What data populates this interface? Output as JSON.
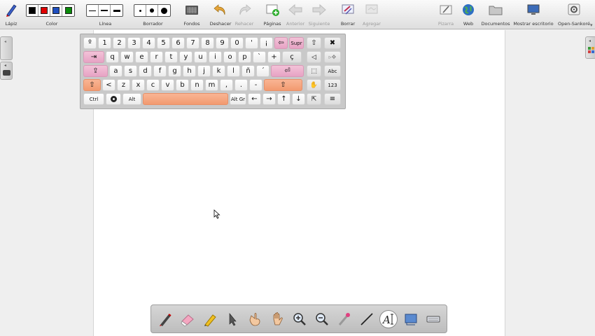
{
  "toolbar": {
    "lapiz": "Lápiz",
    "color": "Color",
    "linea": "Línea",
    "borrador": "Borrador",
    "fondos": "Fondos",
    "deshacer": "Deshacer",
    "rehacer": "Rehacer",
    "paginas": "Páginas",
    "anterior": "Anterior",
    "siguiente": "Siguiente",
    "borrar": "Borrar",
    "agregar": "Agregar",
    "pizarra": "Pizarra",
    "web": "Web",
    "documentos": "Documentos",
    "mostrar_escritorio": "Mostrar escritorio",
    "open_sankore": "Open-Sankoré",
    "colors": [
      "#000000",
      "#e00000",
      "#1f4fbf",
      "#0a8a0a"
    ]
  },
  "keyboard": {
    "row1": [
      "º",
      "1",
      "2",
      "3",
      "4",
      "5",
      "6",
      "7",
      "8",
      "9",
      "0",
      "'",
      "¡",
      "⇦",
      "Supr"
    ],
    "row2": [
      "⇥",
      "q",
      "w",
      "e",
      "r",
      "t",
      "y",
      "u",
      "i",
      "o",
      "p",
      "`",
      "+",
      "ç"
    ],
    "row3": [
      "⇪",
      "a",
      "s",
      "d",
      "f",
      "g",
      "h",
      "j",
      "k",
      "l",
      "ñ",
      "´",
      "⏎"
    ],
    "row4": [
      "⇧",
      "<",
      "z",
      "x",
      "c",
      "v",
      "b",
      "n",
      "m",
      ",",
      ".",
      "-",
      "⇧"
    ],
    "row5": {
      "ctrl": "Ctrl",
      "alt": "Alt",
      "altgr": "Alt Gr",
      "left": "←",
      "right": "→",
      "up": "↑",
      "down": "↓"
    },
    "side": {
      "close": "✖",
      "abc": "Abc",
      "num": "123",
      "menu": "≡"
    }
  }
}
